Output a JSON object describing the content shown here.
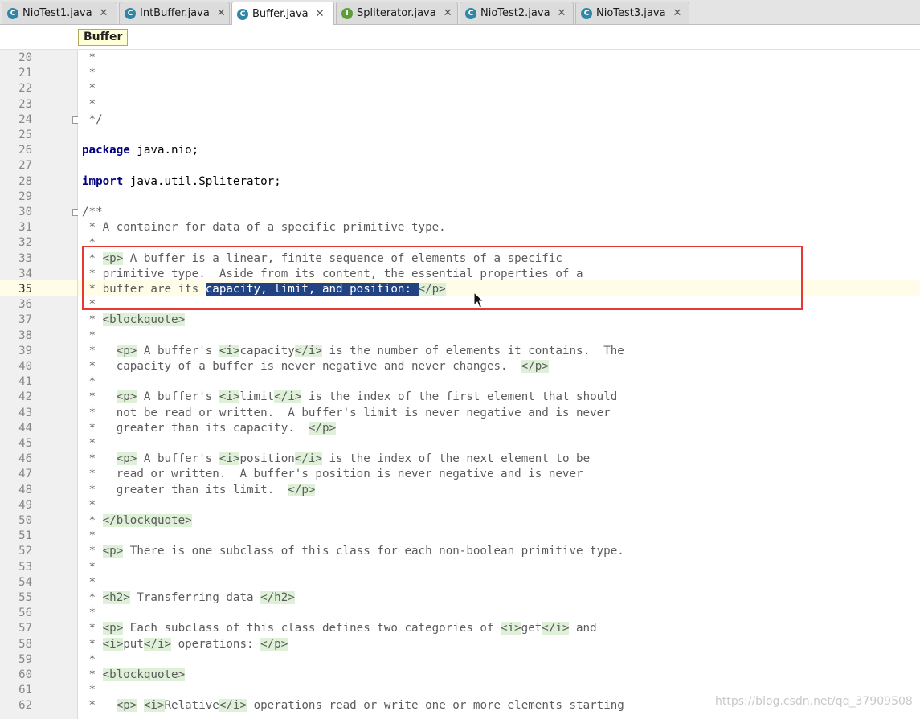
{
  "tabs": [
    {
      "label": "NioTest1.java",
      "icon": "c",
      "active": false
    },
    {
      "label": "IntBuffer.java",
      "icon": "c",
      "active": false
    },
    {
      "label": "Buffer.java",
      "icon": "c",
      "active": true
    },
    {
      "label": "Spliterator.java",
      "icon": "i",
      "active": false
    },
    {
      "label": "NioTest2.java",
      "icon": "c",
      "active": false
    },
    {
      "label": "NioTest3.java",
      "icon": "c",
      "active": false
    }
  ],
  "breadcrumb": "Buffer",
  "current_line": 35,
  "selected_text": "capacity, limit, and position: ",
  "lines": [
    {
      "n": 20,
      "parts": [
        [
          " *",
          ""
        ]
      ]
    },
    {
      "n": 21,
      "parts": [
        [
          " *",
          ""
        ]
      ]
    },
    {
      "n": 22,
      "parts": [
        [
          " *",
          ""
        ]
      ]
    },
    {
      "n": 23,
      "parts": [
        [
          " *",
          ""
        ]
      ]
    },
    {
      "n": 24,
      "parts": [
        [
          " */",
          ""
        ]
      ]
    },
    {
      "n": 25,
      "parts": []
    },
    {
      "n": 26,
      "parts": [
        [
          "package",
          "kw"
        ],
        [
          " java.nio;",
          "pl"
        ]
      ]
    },
    {
      "n": 27,
      "parts": []
    },
    {
      "n": 28,
      "parts": [
        [
          "import",
          "kw"
        ],
        [
          " java.util.Spliterator;",
          "pl"
        ]
      ]
    },
    {
      "n": 29,
      "parts": []
    },
    {
      "n": 30,
      "parts": [
        [
          "/**",
          ""
        ]
      ]
    },
    {
      "n": 31,
      "parts": [
        [
          " * A container for data of a specific primitive type.",
          ""
        ]
      ]
    },
    {
      "n": 32,
      "parts": [
        [
          " *",
          ""
        ]
      ]
    },
    {
      "n": 33,
      "parts": [
        [
          " * ",
          ""
        ],
        [
          "<p>",
          "tag"
        ],
        [
          " A buffer is a linear, finite sequence of elements of a specific",
          ""
        ]
      ]
    },
    {
      "n": 34,
      "parts": [
        [
          " * primitive type.  Aside from its content, the essential properties of a",
          ""
        ]
      ]
    },
    {
      "n": 35,
      "parts": [
        [
          " * buffer are its ",
          ""
        ],
        [
          "capacity, limit, and position: ",
          "sel"
        ],
        [
          "</p>",
          "tag"
        ]
      ]
    },
    {
      "n": 36,
      "parts": [
        [
          " *",
          ""
        ]
      ]
    },
    {
      "n": 37,
      "parts": [
        [
          " * ",
          ""
        ],
        [
          "<blockquote>",
          "tag"
        ]
      ]
    },
    {
      "n": 38,
      "parts": [
        [
          " *",
          ""
        ]
      ]
    },
    {
      "n": 39,
      "parts": [
        [
          " *   ",
          ""
        ],
        [
          "<p>",
          "tag"
        ],
        [
          " A buffer's ",
          ""
        ],
        [
          "<i>",
          "tag"
        ],
        [
          "capacity",
          ""
        ],
        [
          "</i>",
          "tag"
        ],
        [
          " is the number of elements it contains.  The",
          ""
        ]
      ]
    },
    {
      "n": 40,
      "parts": [
        [
          " *   capacity of a buffer is never negative and never changes.  ",
          ""
        ],
        [
          "</p>",
          "tag"
        ]
      ]
    },
    {
      "n": 41,
      "parts": [
        [
          " *",
          ""
        ]
      ]
    },
    {
      "n": 42,
      "parts": [
        [
          " *   ",
          ""
        ],
        [
          "<p>",
          "tag"
        ],
        [
          " A buffer's ",
          ""
        ],
        [
          "<i>",
          "tag"
        ],
        [
          "limit",
          ""
        ],
        [
          "</i>",
          "tag"
        ],
        [
          " is the index of the first element that should",
          ""
        ]
      ]
    },
    {
      "n": 43,
      "parts": [
        [
          " *   not be read or written.  A buffer's limit is never negative and is never",
          ""
        ]
      ]
    },
    {
      "n": 44,
      "parts": [
        [
          " *   greater than its capacity.  ",
          ""
        ],
        [
          "</p>",
          "tag"
        ]
      ]
    },
    {
      "n": 45,
      "parts": [
        [
          " *",
          ""
        ]
      ]
    },
    {
      "n": 46,
      "parts": [
        [
          " *   ",
          ""
        ],
        [
          "<p>",
          "tag"
        ],
        [
          " A buffer's ",
          ""
        ],
        [
          "<i>",
          "tag"
        ],
        [
          "position",
          ""
        ],
        [
          "</i>",
          "tag"
        ],
        [
          " is the index of the next element to be",
          ""
        ]
      ]
    },
    {
      "n": 47,
      "parts": [
        [
          " *   read or written.  A buffer's position is never negative and is never",
          ""
        ]
      ]
    },
    {
      "n": 48,
      "parts": [
        [
          " *   greater than its limit.  ",
          ""
        ],
        [
          "</p>",
          "tag"
        ]
      ]
    },
    {
      "n": 49,
      "parts": [
        [
          " *",
          ""
        ]
      ]
    },
    {
      "n": 50,
      "parts": [
        [
          " * ",
          ""
        ],
        [
          "</blockquote>",
          "tag"
        ]
      ]
    },
    {
      "n": 51,
      "parts": [
        [
          " *",
          ""
        ]
      ]
    },
    {
      "n": 52,
      "parts": [
        [
          " * ",
          ""
        ],
        [
          "<p>",
          "tag"
        ],
        [
          " There is one subclass of this class for each non-boolean primitive type.",
          ""
        ]
      ]
    },
    {
      "n": 53,
      "parts": [
        [
          " *",
          ""
        ]
      ]
    },
    {
      "n": 54,
      "parts": [
        [
          " *",
          ""
        ]
      ]
    },
    {
      "n": 55,
      "parts": [
        [
          " * ",
          ""
        ],
        [
          "<h2>",
          "tag"
        ],
        [
          " Transferring data ",
          ""
        ],
        [
          "</h2>",
          "tag"
        ]
      ]
    },
    {
      "n": 56,
      "parts": [
        [
          " *",
          ""
        ]
      ]
    },
    {
      "n": 57,
      "parts": [
        [
          " * ",
          ""
        ],
        [
          "<p>",
          "tag"
        ],
        [
          " Each subclass of this class defines two categories of ",
          ""
        ],
        [
          "<i>",
          "tag"
        ],
        [
          "get",
          ""
        ],
        [
          "</i>",
          "tag"
        ],
        [
          " and",
          ""
        ]
      ]
    },
    {
      "n": 58,
      "parts": [
        [
          " * ",
          ""
        ],
        [
          "<i>",
          "tag"
        ],
        [
          "put",
          ""
        ],
        [
          "</i>",
          "tag"
        ],
        [
          " operations: ",
          ""
        ],
        [
          "</p>",
          "tag"
        ]
      ]
    },
    {
      "n": 59,
      "parts": [
        [
          " *",
          ""
        ]
      ]
    },
    {
      "n": 60,
      "parts": [
        [
          " * ",
          ""
        ],
        [
          "<blockquote>",
          "tag"
        ]
      ]
    },
    {
      "n": 61,
      "parts": [
        [
          " *",
          ""
        ]
      ]
    },
    {
      "n": 62,
      "parts": [
        [
          " *   ",
          ""
        ],
        [
          "<p>",
          "tag"
        ],
        [
          " ",
          ""
        ],
        [
          "<i>",
          "tag"
        ],
        [
          "Relative",
          ""
        ],
        [
          "</i>",
          "tag"
        ],
        [
          " operations read or write one or more elements starting",
          ""
        ]
      ]
    }
  ],
  "watermark": "https://blog.csdn.net/qq_37909508",
  "icons": {
    "class": "class-icon",
    "interface": "interface-icon",
    "close": "close-icon",
    "fold": "fold-marker-icon",
    "cursor": "mouse-cursor-icon"
  },
  "colors": {
    "keyword": "#000080",
    "comment": "#5b5b5b",
    "tag_bg": "#dff0d8",
    "selection": "#214283",
    "highlight_box": "#e53935",
    "caret_row": "#fffde7"
  }
}
